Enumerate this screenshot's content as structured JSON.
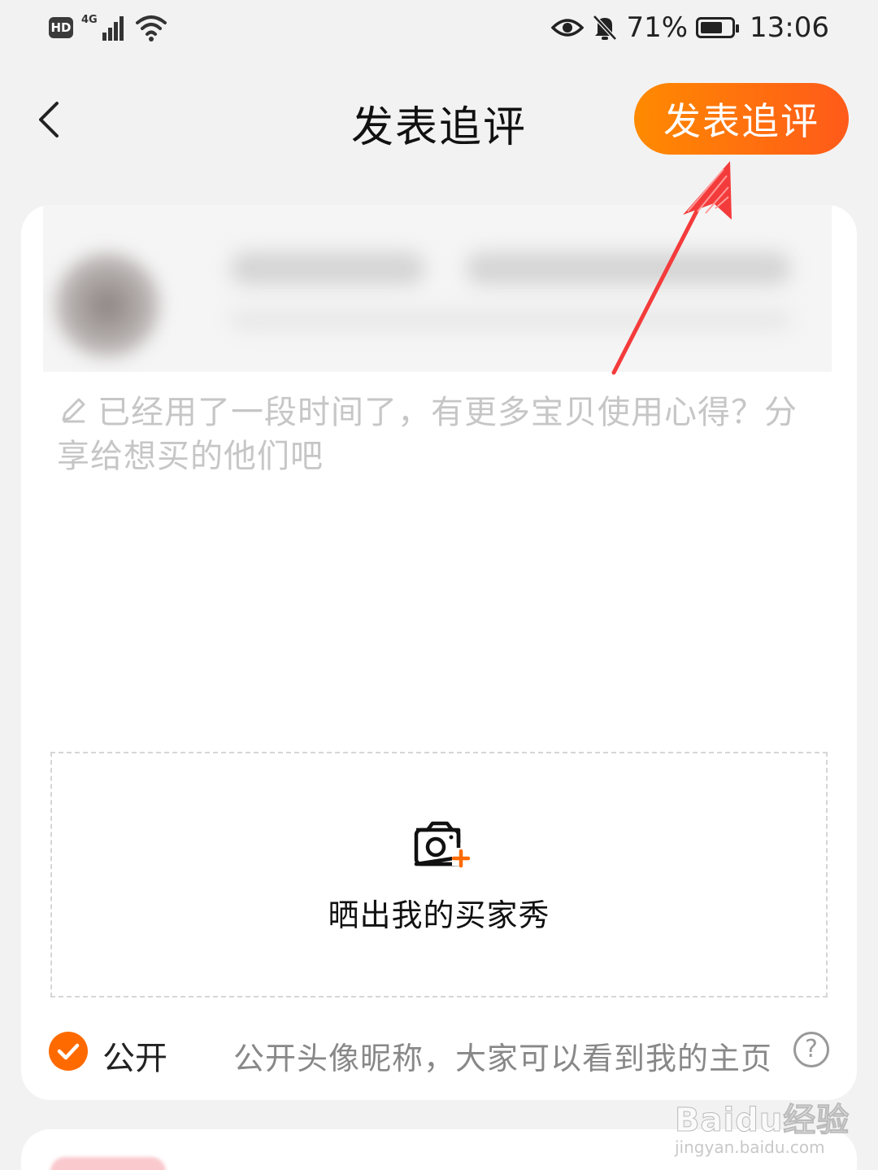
{
  "status_bar": {
    "hd_badge": "HD",
    "network": "4G",
    "battery_percent": "71%",
    "battery_level": 0.71,
    "time": "13:06"
  },
  "header": {
    "back_icon": "chevron-left-icon",
    "title": "发表追评",
    "publish_button": "发表追评"
  },
  "colors": {
    "accent": "#ff6a00",
    "button_gradient_start": "#ff8a00",
    "button_gradient_end": "#ff5a1a",
    "annotation_arrow": "#f43b3b"
  },
  "comment": {
    "placeholder": "已经用了一段时间了，有更多宝贝使用心得？分享给想买的他们吧",
    "icon": "pencil-icon"
  },
  "upload": {
    "icon": "camera-plus-icon",
    "label": "晒出我的买家秀"
  },
  "privacy": {
    "checked": true,
    "label": "公开",
    "description": "公开头像昵称，大家可以看到我的主页",
    "help_icon": "question-icon",
    "help_glyph": "?"
  },
  "watermark": {
    "main": "Baidu经验",
    "sub": "jingyan.baidu.com"
  }
}
